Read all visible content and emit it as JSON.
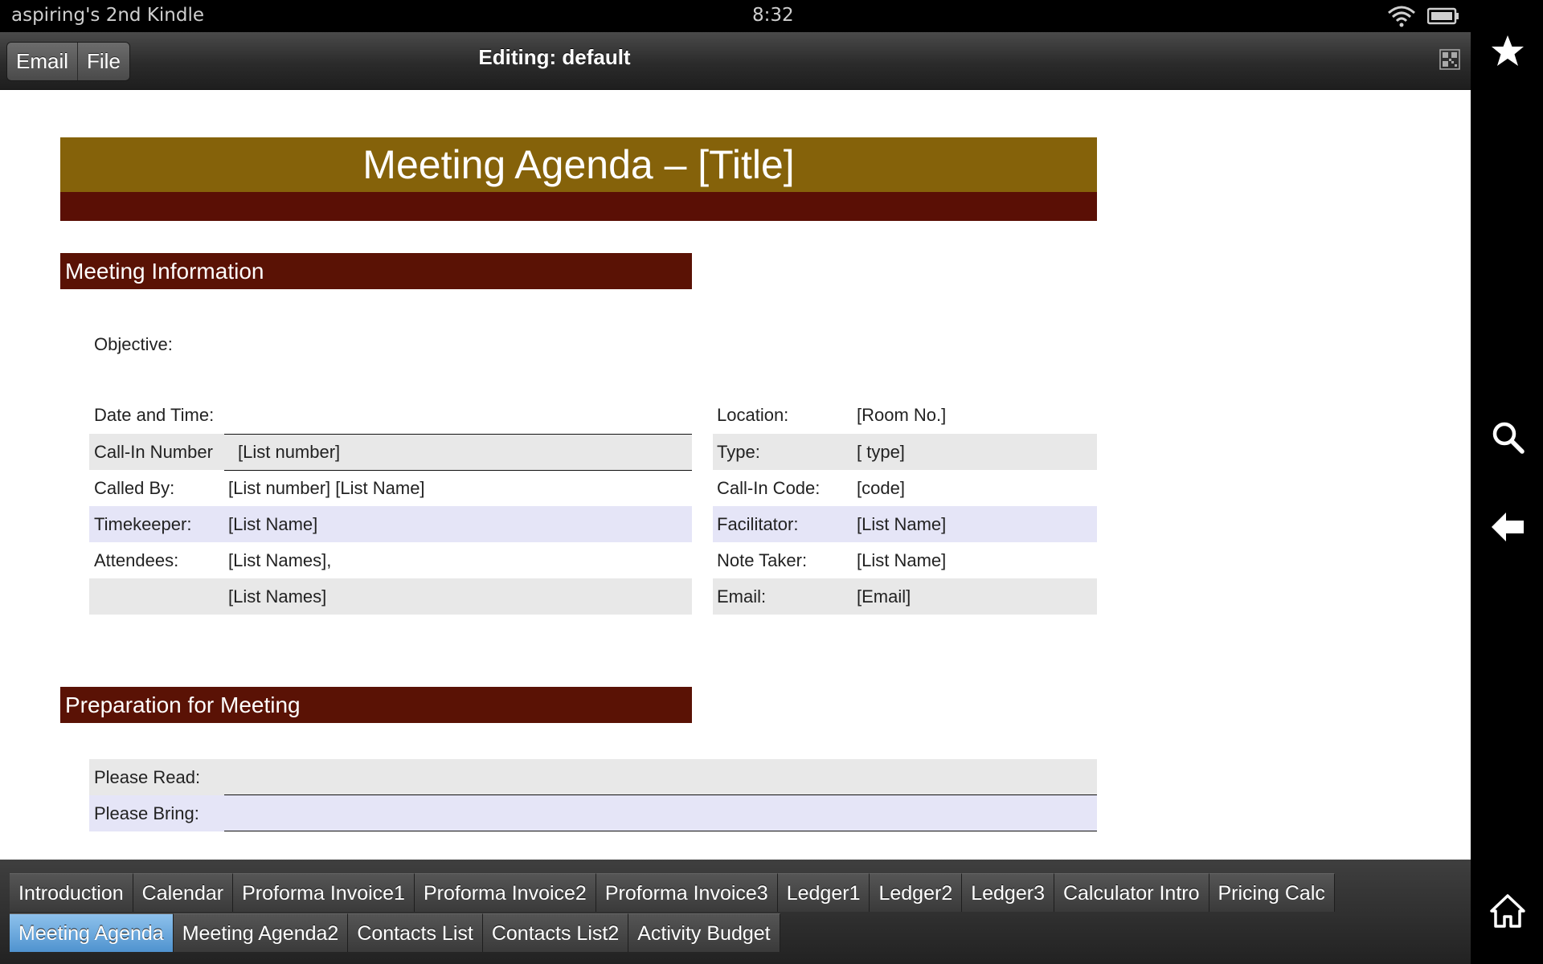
{
  "status_bar": {
    "device_name": "aspiring's 2nd Kindle",
    "time": "8:32",
    "icons": [
      "wifi-icon",
      "battery-icon"
    ]
  },
  "toolbar": {
    "email_label": "Email",
    "file_label": "File",
    "title": "Editing: default",
    "grid_icon": "qr-grid-icon"
  },
  "right_nav": {
    "icons": [
      "star-icon",
      "search-icon",
      "back-arrow-icon",
      "home-icon"
    ]
  },
  "sheet": {
    "title": "Meeting Agenda – [Title]",
    "section_info": "Meeting Information",
    "objective_label": "Objective:",
    "left_rows": [
      {
        "label": "Date and Time:",
        "value": ""
      },
      {
        "label": "Call-In Number",
        "value": "[List number]"
      },
      {
        "label": "Called By:",
        "value": "[List number] [List Name]"
      },
      {
        "label": "Timekeeper:",
        "value": "[List Name]"
      },
      {
        "label": "Attendees:",
        "value": "[List Names],"
      },
      {
        "label": "",
        "value": "[List Names]"
      }
    ],
    "right_rows": [
      {
        "label": "Location:",
        "value": "[Room No.]"
      },
      {
        "label": "Type:",
        "value": "[ type]"
      },
      {
        "label": "Call-In Code:",
        "value": "[code]"
      },
      {
        "label": "Facilitator:",
        "value": "[List Name]"
      },
      {
        "label": "Note Taker:",
        "value": "[List Name]"
      },
      {
        "label": "Email:",
        "value": "[Email]"
      }
    ],
    "section_prep": "Preparation for Meeting",
    "please_read_label": "Please Read:",
    "please_bring_label": "Please Bring:"
  },
  "sheet_tabs": {
    "row1": [
      "Introduction",
      "Calendar",
      "Proforma Invoice1",
      "Proforma Invoice2",
      "Proforma Invoice3",
      "Ledger1",
      "Ledger2",
      "Ledger3",
      "Calculator Intro",
      "Pricing Calc"
    ],
    "row2": [
      "Meeting Agenda",
      "Meeting Agenda2",
      "Contacts List",
      "Contacts List2",
      "Activity Budget"
    ],
    "active": "Meeting Agenda"
  },
  "colors": {
    "title_band": "#85620a",
    "section_band": "#5a1205",
    "row_gray": "#e8e8e8",
    "row_lavender": "#e5e5f7",
    "active_tab": "#6aa8de"
  }
}
